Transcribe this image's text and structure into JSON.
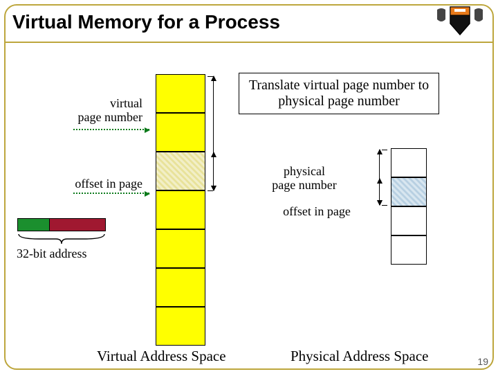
{
  "title": "Virtual Memory for a Process",
  "translate_box": "Translate virtual page number to physical page number",
  "labels": {
    "vpn": "virtual\npage number",
    "offset_v": "offset in page",
    "ppn": "physical\npage number",
    "offset_p": "offset in page",
    "addr": "32-bit address"
  },
  "captions": {
    "vspace": "Virtual Address Space",
    "pspace": "Physical Address Space"
  },
  "slide_number": "19"
}
